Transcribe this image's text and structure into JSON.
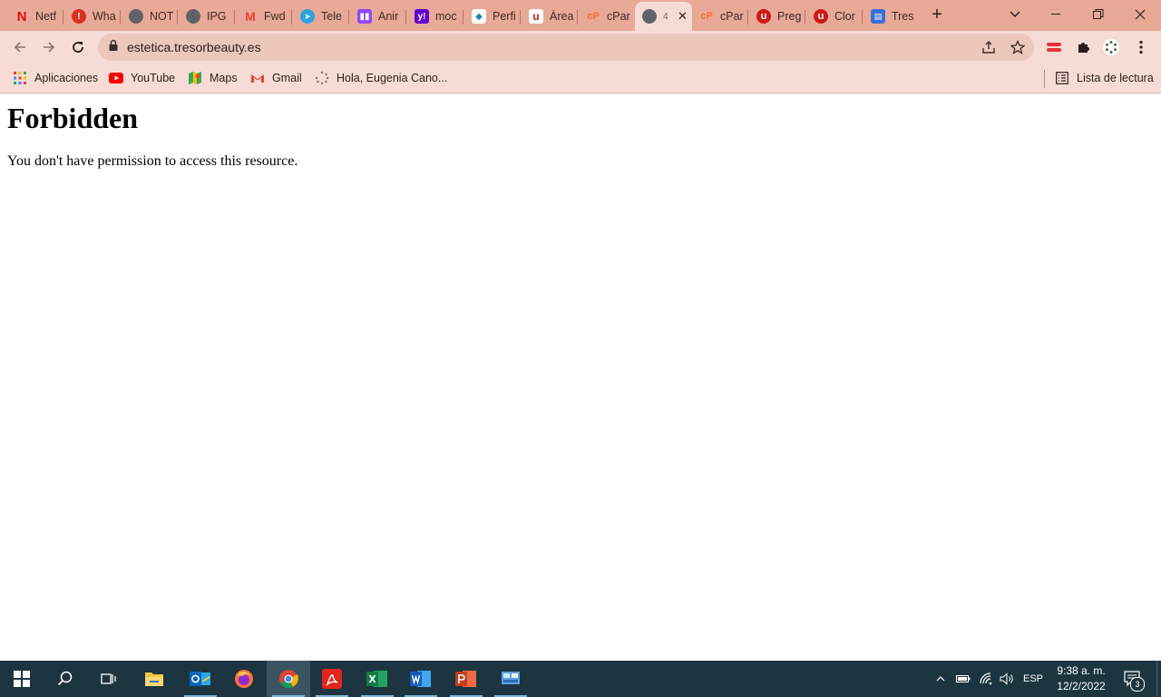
{
  "tabs": [
    {
      "title": "Netf",
      "icon": "netflix-icon",
      "color": "#e50914"
    },
    {
      "title": "Wha",
      "icon": "alert-icon",
      "color": "#d93025"
    },
    {
      "title": "NOT",
      "icon": "globe-icon",
      "color": "#5f6368"
    },
    {
      "title": "IPG",
      "icon": "globe-icon",
      "color": "#5f6368"
    },
    {
      "title": "Fwd",
      "icon": "gmail-icon",
      "color": "#ea4335"
    },
    {
      "title": "Tele",
      "icon": "telegram-icon",
      "color": "#2aa3df"
    },
    {
      "title": "Anir",
      "icon": "twitch-icon",
      "color": "#9146ff"
    },
    {
      "title": "moc",
      "icon": "yahoo-icon",
      "color": "#6001d2"
    },
    {
      "title": "Perfi",
      "icon": "leaf-icon",
      "color": "#1e88a8"
    },
    {
      "title": "Área",
      "icon": "u-logo-icon",
      "color": "#cc1a1a"
    },
    {
      "title": "cPar",
      "icon": "cpanel-icon",
      "color": "#ff6c2c"
    },
    {
      "title": "4",
      "icon": "globe-icon",
      "color": "#5f6368",
      "active": true
    },
    {
      "title": "cPar",
      "icon": "cpanel-icon",
      "color": "#ff6c2c"
    },
    {
      "title": "Preg",
      "icon": "u-logo-icon",
      "color": "#cc1a1a"
    },
    {
      "title": "Clor",
      "icon": "u-logo-icon",
      "color": "#cc1a1a"
    },
    {
      "title": "Tres",
      "icon": "book-icon",
      "color": "#3a6fd8"
    }
  ],
  "toolbar": {
    "url": "estetica.tresorbeauty.es"
  },
  "bookmarks": {
    "items": [
      {
        "label": "Aplicaciones",
        "icon": "apps-grid-icon"
      },
      {
        "label": "YouTube",
        "icon": "youtube-icon"
      },
      {
        "label": "Maps",
        "icon": "maps-icon"
      },
      {
        "label": "Gmail",
        "icon": "gmail-icon"
      },
      {
        "label": "Hola, Eugenia Cano...",
        "icon": "loading-icon"
      }
    ],
    "reading_list": "Lista de lectura"
  },
  "page": {
    "heading": "Forbidden",
    "message": "You don't have permission to access this resource."
  },
  "taskbar": {
    "apps": [
      "start-icon",
      "search-icon",
      "task-view-icon",
      "file-explorer-icon",
      "outlook-icon",
      "firefox-icon",
      "chrome-icon",
      "acrobat-icon",
      "excel-icon",
      "word-icon",
      "powerpoint-icon",
      "control-panel-icon"
    ],
    "language": "ESP",
    "time": "9:38 a. m.",
    "date": "12/2/2022",
    "notifications": "3"
  },
  "colors": {
    "tab_strip": "#e9a997",
    "toolbar": "#f6dcd5",
    "omnibox": "#ecc7bc",
    "taskbar": "#1c3540"
  }
}
